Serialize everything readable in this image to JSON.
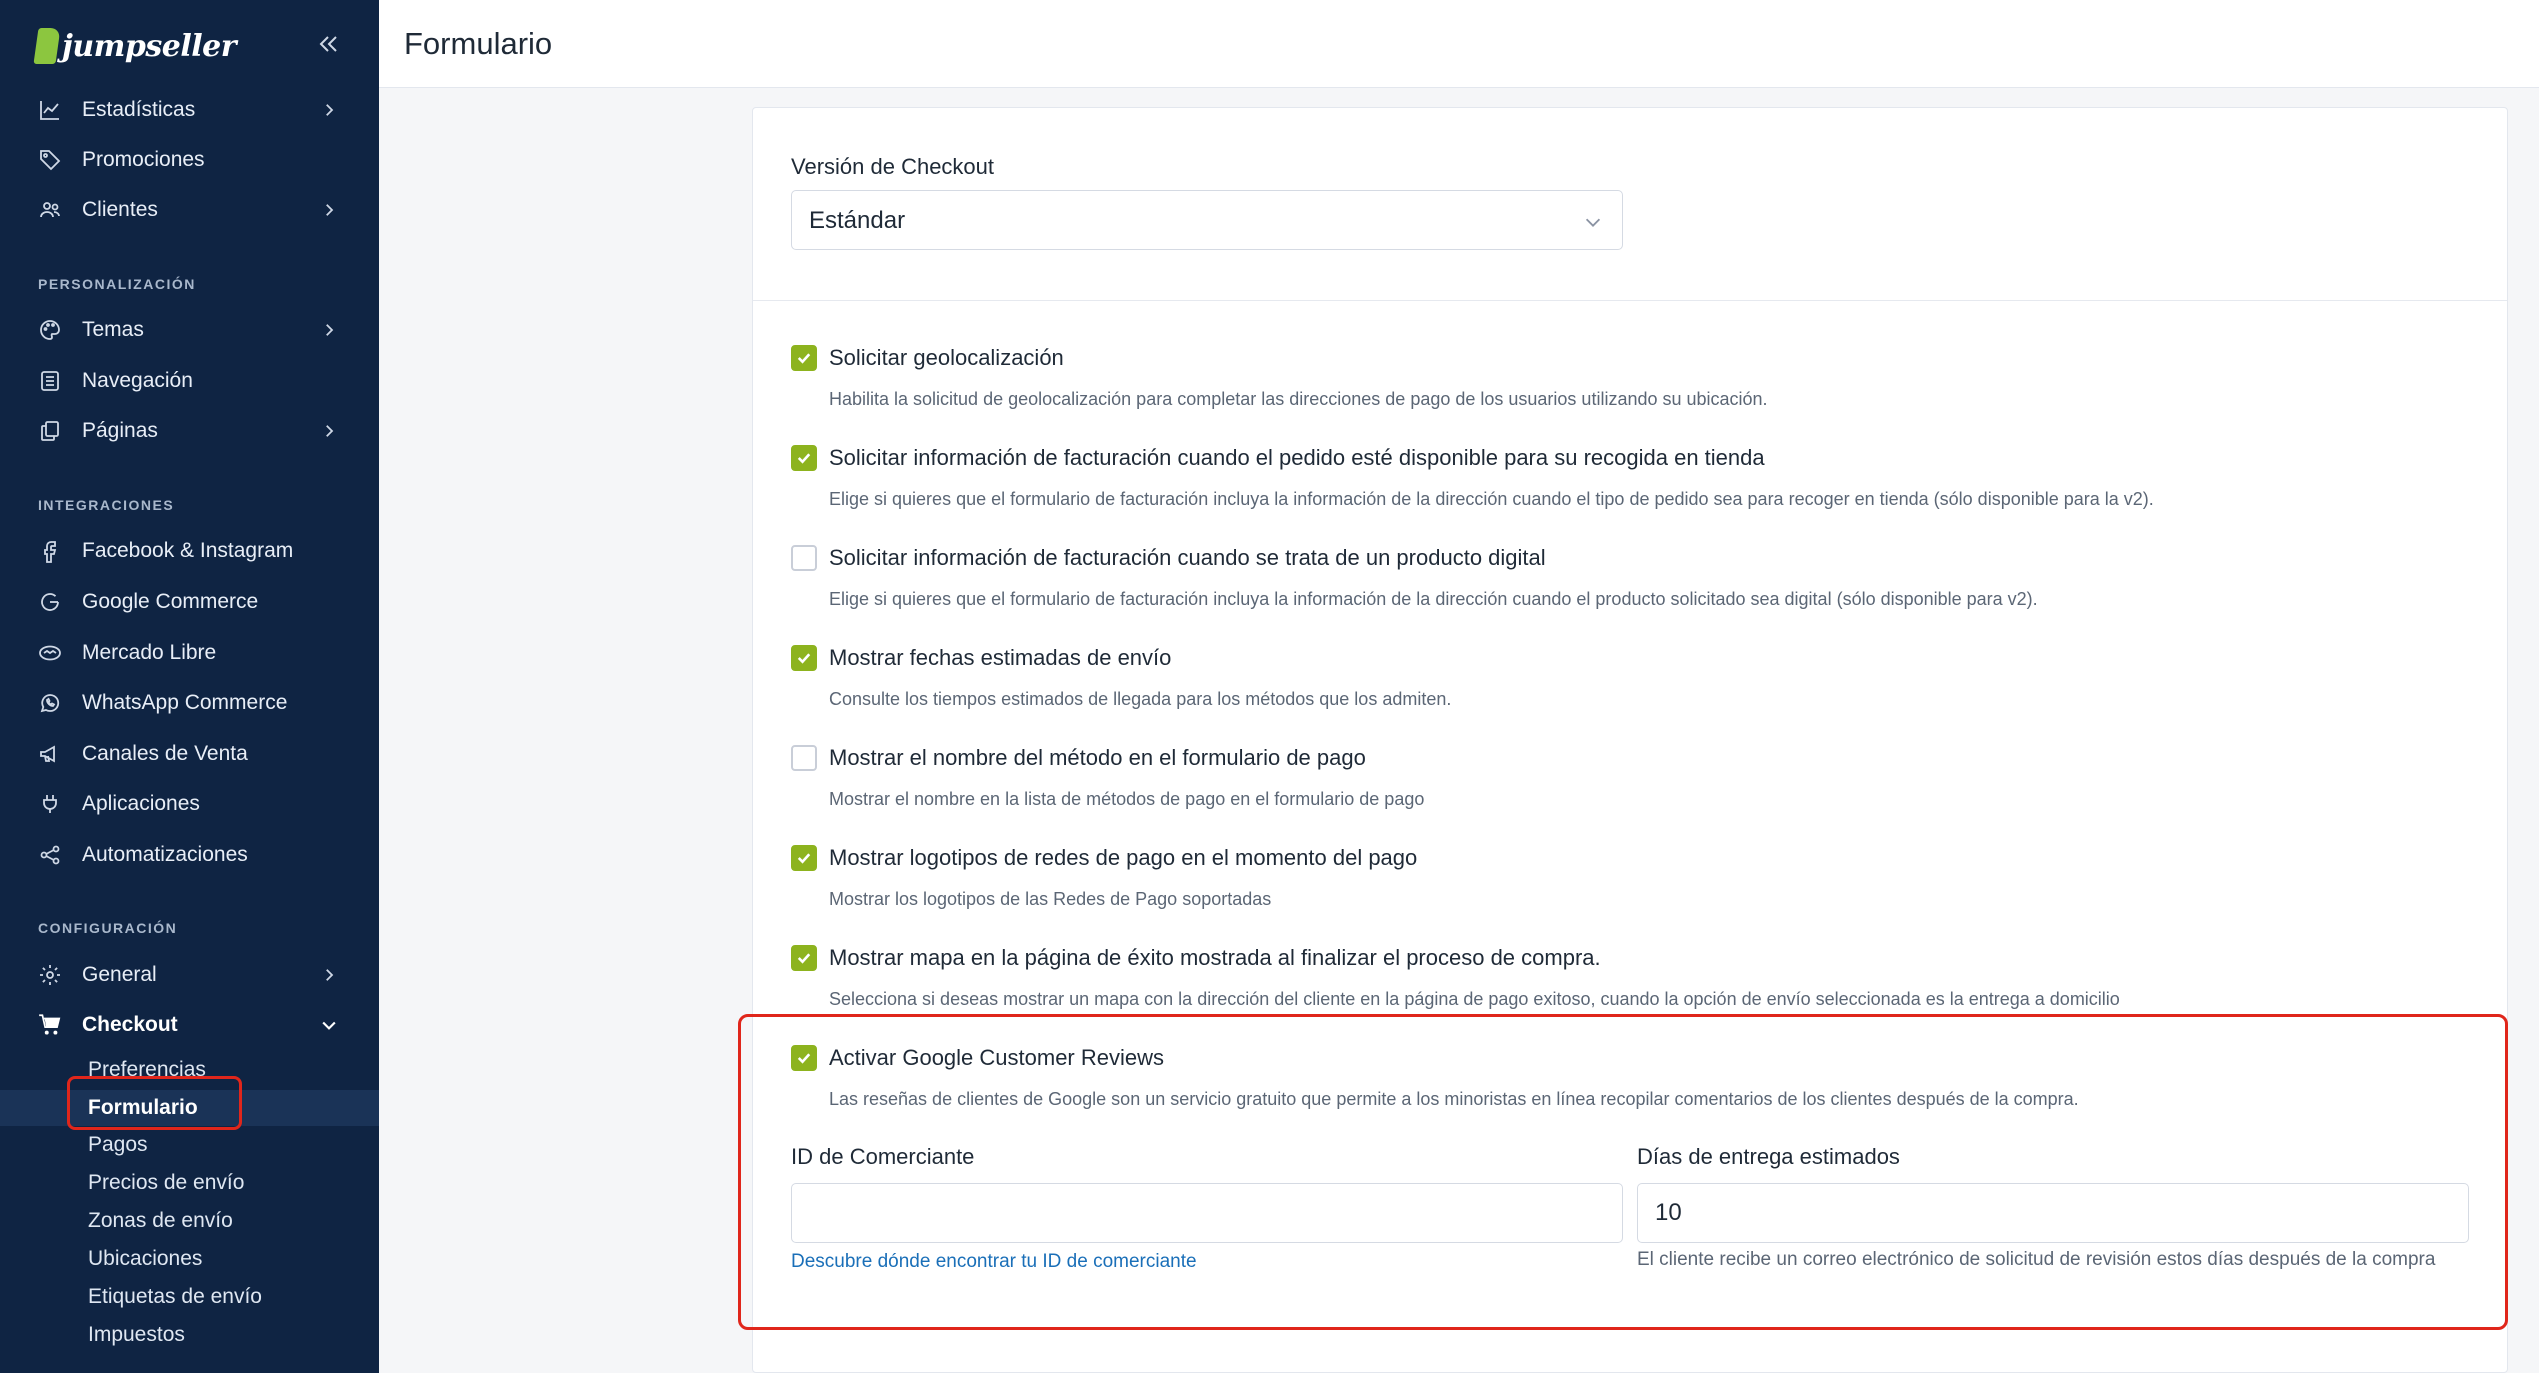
{
  "brand": {
    "name": "jumpseller"
  },
  "sidebar": {
    "items_top": [
      {
        "label": "Estadísticas",
        "icon": "chart-line-icon",
        "has_children": true
      },
      {
        "label": "Promociones",
        "icon": "tag-icon",
        "has_children": false
      },
      {
        "label": "Clientes",
        "icon": "users-icon",
        "has_children": true
      }
    ],
    "section_personalizacion": "PERSONALIZACIÓN",
    "items_personalizacion": [
      {
        "label": "Temas",
        "icon": "palette-icon",
        "has_children": true
      },
      {
        "label": "Navegación",
        "icon": "list-icon",
        "has_children": false
      },
      {
        "label": "Páginas",
        "icon": "pages-icon",
        "has_children": true
      }
    ],
    "section_integraciones": "INTEGRACIONES",
    "items_integraciones": [
      {
        "label": "Facebook & Instagram",
        "icon": "facebook-icon"
      },
      {
        "label": "Google Commerce",
        "icon": "google-icon"
      },
      {
        "label": "Mercado Libre",
        "icon": "handshake-icon"
      },
      {
        "label": "WhatsApp Commerce",
        "icon": "whatsapp-icon"
      },
      {
        "label": "Canales de Venta",
        "icon": "megaphone-icon"
      },
      {
        "label": "Aplicaciones",
        "icon": "plug-icon"
      },
      {
        "label": "Automatizaciones",
        "icon": "share-nodes-icon"
      }
    ],
    "section_configuracion": "CONFIGURACIÓN",
    "items_configuracion": [
      {
        "label": "General",
        "icon": "gear-icon",
        "has_children": true
      },
      {
        "label": "Checkout",
        "icon": "cart-icon",
        "expanded": true
      }
    ],
    "checkout_subitems": [
      {
        "label": "Preferencias"
      },
      {
        "label": "Formulario",
        "active": true
      },
      {
        "label": "Pagos"
      },
      {
        "label": "Precios de envío"
      },
      {
        "label": "Zonas de envío"
      },
      {
        "label": "Ubicaciones"
      },
      {
        "label": "Etiquetas de envío"
      },
      {
        "label": "Impuestos"
      }
    ]
  },
  "header": {
    "title": "Formulario"
  },
  "checkout_version": {
    "label": "Versión de Checkout",
    "value": "Estándar"
  },
  "options": [
    {
      "title": "Solicitar geolocalización",
      "desc": "Habilita la solicitud de geolocalización para completar las direcciones de pago de los usuarios utilizando su ubicación.",
      "checked": true
    },
    {
      "title": "Solicitar información de facturación cuando el pedido esté disponible para su recogida en tienda",
      "desc": "Elige si quieres que el formulario de facturación incluya la información de la dirección cuando el tipo de pedido sea para recoger en tienda (sólo disponible para la v2).",
      "checked": true
    },
    {
      "title": "Solicitar información de facturación cuando se trata de un producto digital",
      "desc": "Elige si quieres que el formulario de facturación incluya la información de la dirección cuando el producto solicitado sea digital (sólo disponible para v2).",
      "checked": false
    },
    {
      "title": "Mostrar fechas estimadas de envío",
      "desc": "Consulte los tiempos estimados de llegada para los métodos que los admiten.",
      "checked": true
    },
    {
      "title": "Mostrar el nombre del método en el formulario de pago",
      "desc": "Mostrar el nombre en la lista de métodos de pago en el formulario de pago",
      "checked": false
    },
    {
      "title": "Mostrar logotipos de redes de pago en el momento del pago",
      "desc": "Mostrar los logotipos de las Redes de Pago soportadas",
      "checked": true
    },
    {
      "title": "Mostrar mapa en la página de éxito mostrada al finalizar el proceso de compra.",
      "desc": "Selecciona si deseas mostrar un mapa con la dirección del cliente en la página de pago exitoso, cuando la opción de envío seleccionada es la entrega a domicilio",
      "checked": true
    },
    {
      "title": "Activar Google Customer Reviews",
      "desc": "Las reseñas de clientes de Google son un servicio gratuito que permite a los minoristas en línea recopilar comentarios de los clientes después de la compra.",
      "checked": true
    }
  ],
  "merchant": {
    "label": "ID de Comerciante",
    "value": "",
    "help_link": "Descubre dónde encontrar tu ID de comerciante"
  },
  "delivery_days": {
    "label": "Días de entrega estimados",
    "value": "10",
    "help": "El cliente recibe un correo electrónico de solicitud de revisión estos días después de la compra"
  },
  "colors": {
    "sidebar_bg": "#0f2443",
    "accent_green": "#8db31e",
    "highlight_red": "#e0261b",
    "link_blue": "#1a6fb8"
  }
}
